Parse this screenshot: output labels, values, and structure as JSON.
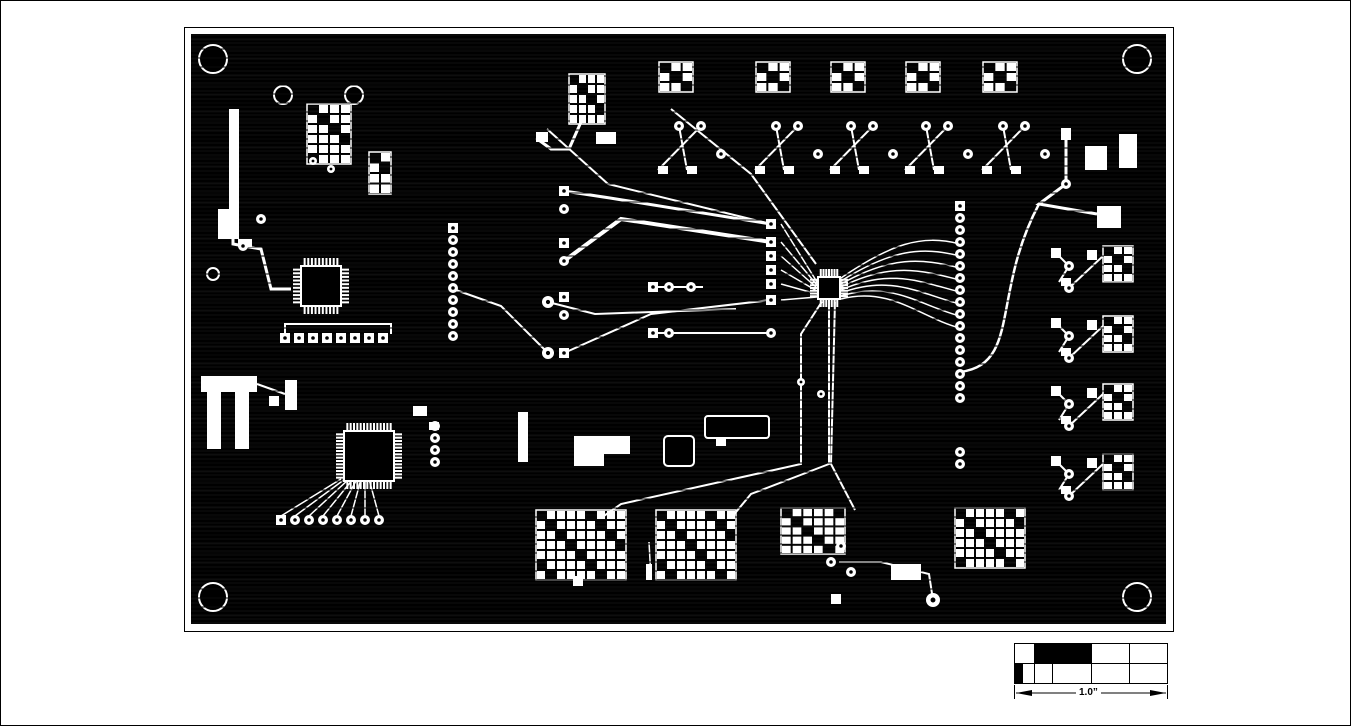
{
  "scale_bar": {
    "label": "1.0”"
  },
  "colors": {
    "copper": "#000000",
    "trace": "#ffffff",
    "paper": "#ffffff"
  }
}
